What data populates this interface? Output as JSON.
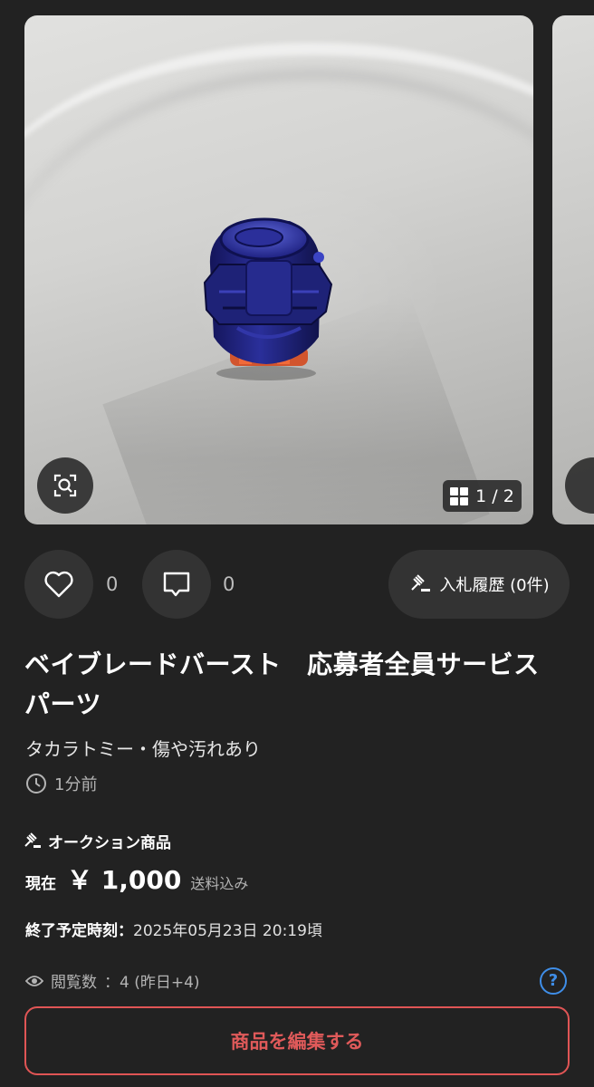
{
  "gallery": {
    "counter_current": "1",
    "counter_separator": "/",
    "counter_total": "2",
    "zoom_icon": "zoom-scan-icon",
    "grid_icon": "grid-icon",
    "product_photo_subject": "blue spinning top part on white surface"
  },
  "actions": {
    "like_count": "0",
    "comment_count": "0",
    "bid_history_label": "入札履歴 (0件)",
    "like_icon": "heart-icon",
    "comment_icon": "chat-bubble-icon",
    "bid_icon": "gavel-icon"
  },
  "item": {
    "title": "ベイブレードバースト　応募者全員サービス　パーツ",
    "subtitle": "タカラトミー・傷や汚れあり",
    "posted_time": "1分前",
    "auction_label": "オークション商品",
    "price_prefix": "現在",
    "price": "￥ 1,000",
    "price_note": "送料込み",
    "end_label": "終了予定時刻：",
    "end_value": "2025年05月23日 20:19頃",
    "views_label": "閲覧数",
    "views_value": "：4 (昨日+4)",
    "help_symbol": "?"
  },
  "footer": {
    "edit_button_label": "商品を編集する"
  },
  "colors": {
    "background": "#222222",
    "surface": "#333333",
    "danger": "#e05555",
    "link": "#3f8ee8"
  }
}
